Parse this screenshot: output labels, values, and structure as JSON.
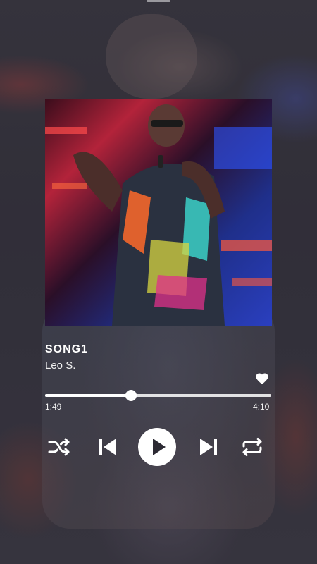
{
  "player": {
    "song_title": "SONG1",
    "artist": "Leo S.",
    "elapsed": "1:49",
    "duration": "4:10",
    "progress_fraction": 0.38
  },
  "icons": {
    "favorite": "heart-icon",
    "shuffle": "shuffle-icon",
    "previous": "skip-previous-icon",
    "play": "play-icon",
    "next": "skip-next-icon",
    "repeat": "repeat-icon"
  },
  "colors": {
    "text": "#ffffff",
    "control": "#ffffff",
    "play_button_bg": "#ffffff",
    "play_glyph": "#2c2a33"
  }
}
